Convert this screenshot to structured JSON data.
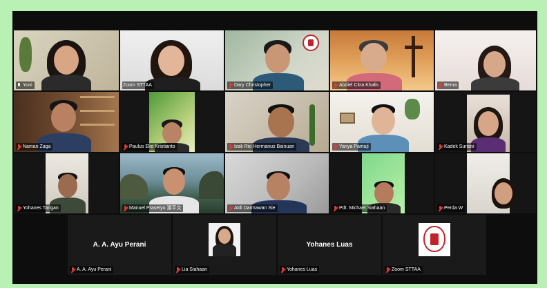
{
  "participants": [
    {
      "name": "Yuni",
      "mic": "on"
    },
    {
      "name": "Zoom STTAA",
      "mic": "none"
    },
    {
      "name": "Dary Christopher",
      "mic": "muted"
    },
    {
      "name": "Abdiel Citra Khalis",
      "mic": "muted"
    },
    {
      "name": "Bema",
      "mic": "muted"
    },
    {
      "name": "Naman Zaga",
      "mic": "muted"
    },
    {
      "name": "Paulus Eko Kristianto",
      "mic": "muted"
    },
    {
      "name": "Izak Rio Hermanus Bainuan",
      "mic": "muted"
    },
    {
      "name": "Yanya Pamuji",
      "mic": "muted"
    },
    {
      "name": "Kadek Suriani",
      "mic": "muted"
    },
    {
      "name": "Yohanes Tarigan",
      "mic": "muted"
    },
    {
      "name": "Manuel Prasetyo 潘平文",
      "mic": "muted"
    },
    {
      "name": "Aldi Darmawan Sie",
      "mic": "muted"
    },
    {
      "name": "Pdt. Michael Siahaan",
      "mic": "muted"
    },
    {
      "name": "Perda W",
      "mic": "muted"
    },
    {
      "name": "A. A. Ayu Perani",
      "mic": "muted",
      "display_name": "A. A. Ayu Perani"
    },
    {
      "name": "Lia Siahaan",
      "mic": "muted"
    },
    {
      "name": "Yohanes Luas",
      "mic": "muted",
      "display_name": "Yohanes Luas"
    },
    {
      "name": "Zoom STTAA",
      "mic": "muted"
    }
  ],
  "colors": {
    "page_background": "#b9f0b3",
    "window_background": "#0d0d0d",
    "active_speaker_border": "#d7e84a",
    "muted_mic": "#e23b3b"
  }
}
